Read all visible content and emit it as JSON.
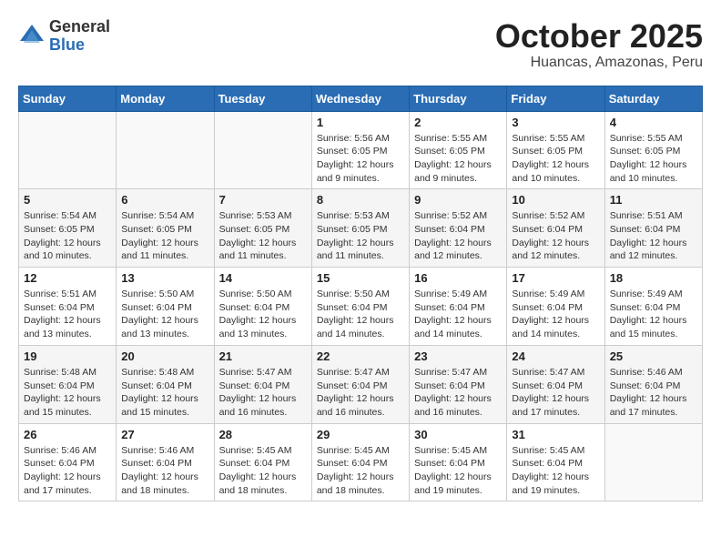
{
  "logo": {
    "general": "General",
    "blue": "Blue"
  },
  "header": {
    "month": "October 2025",
    "location": "Huancas, Amazonas, Peru"
  },
  "days_of_week": [
    "Sunday",
    "Monday",
    "Tuesday",
    "Wednesday",
    "Thursday",
    "Friday",
    "Saturday"
  ],
  "weeks": [
    [
      {
        "day": "",
        "info": ""
      },
      {
        "day": "",
        "info": ""
      },
      {
        "day": "",
        "info": ""
      },
      {
        "day": "1",
        "info": "Sunrise: 5:56 AM\nSunset: 6:05 PM\nDaylight: 12 hours\nand 9 minutes."
      },
      {
        "day": "2",
        "info": "Sunrise: 5:55 AM\nSunset: 6:05 PM\nDaylight: 12 hours\nand 9 minutes."
      },
      {
        "day": "3",
        "info": "Sunrise: 5:55 AM\nSunset: 6:05 PM\nDaylight: 12 hours\nand 10 minutes."
      },
      {
        "day": "4",
        "info": "Sunrise: 5:55 AM\nSunset: 6:05 PM\nDaylight: 12 hours\nand 10 minutes."
      }
    ],
    [
      {
        "day": "5",
        "info": "Sunrise: 5:54 AM\nSunset: 6:05 PM\nDaylight: 12 hours\nand 10 minutes."
      },
      {
        "day": "6",
        "info": "Sunrise: 5:54 AM\nSunset: 6:05 PM\nDaylight: 12 hours\nand 11 minutes."
      },
      {
        "day": "7",
        "info": "Sunrise: 5:53 AM\nSunset: 6:05 PM\nDaylight: 12 hours\nand 11 minutes."
      },
      {
        "day": "8",
        "info": "Sunrise: 5:53 AM\nSunset: 6:05 PM\nDaylight: 12 hours\nand 11 minutes."
      },
      {
        "day": "9",
        "info": "Sunrise: 5:52 AM\nSunset: 6:04 PM\nDaylight: 12 hours\nand 12 minutes."
      },
      {
        "day": "10",
        "info": "Sunrise: 5:52 AM\nSunset: 6:04 PM\nDaylight: 12 hours\nand 12 minutes."
      },
      {
        "day": "11",
        "info": "Sunrise: 5:51 AM\nSunset: 6:04 PM\nDaylight: 12 hours\nand 12 minutes."
      }
    ],
    [
      {
        "day": "12",
        "info": "Sunrise: 5:51 AM\nSunset: 6:04 PM\nDaylight: 12 hours\nand 13 minutes."
      },
      {
        "day": "13",
        "info": "Sunrise: 5:50 AM\nSunset: 6:04 PM\nDaylight: 12 hours\nand 13 minutes."
      },
      {
        "day": "14",
        "info": "Sunrise: 5:50 AM\nSunset: 6:04 PM\nDaylight: 12 hours\nand 13 minutes."
      },
      {
        "day": "15",
        "info": "Sunrise: 5:50 AM\nSunset: 6:04 PM\nDaylight: 12 hours\nand 14 minutes."
      },
      {
        "day": "16",
        "info": "Sunrise: 5:49 AM\nSunset: 6:04 PM\nDaylight: 12 hours\nand 14 minutes."
      },
      {
        "day": "17",
        "info": "Sunrise: 5:49 AM\nSunset: 6:04 PM\nDaylight: 12 hours\nand 14 minutes."
      },
      {
        "day": "18",
        "info": "Sunrise: 5:49 AM\nSunset: 6:04 PM\nDaylight: 12 hours\nand 15 minutes."
      }
    ],
    [
      {
        "day": "19",
        "info": "Sunrise: 5:48 AM\nSunset: 6:04 PM\nDaylight: 12 hours\nand 15 minutes."
      },
      {
        "day": "20",
        "info": "Sunrise: 5:48 AM\nSunset: 6:04 PM\nDaylight: 12 hours\nand 15 minutes."
      },
      {
        "day": "21",
        "info": "Sunrise: 5:47 AM\nSunset: 6:04 PM\nDaylight: 12 hours\nand 16 minutes."
      },
      {
        "day": "22",
        "info": "Sunrise: 5:47 AM\nSunset: 6:04 PM\nDaylight: 12 hours\nand 16 minutes."
      },
      {
        "day": "23",
        "info": "Sunrise: 5:47 AM\nSunset: 6:04 PM\nDaylight: 12 hours\nand 16 minutes."
      },
      {
        "day": "24",
        "info": "Sunrise: 5:47 AM\nSunset: 6:04 PM\nDaylight: 12 hours\nand 17 minutes."
      },
      {
        "day": "25",
        "info": "Sunrise: 5:46 AM\nSunset: 6:04 PM\nDaylight: 12 hours\nand 17 minutes."
      }
    ],
    [
      {
        "day": "26",
        "info": "Sunrise: 5:46 AM\nSunset: 6:04 PM\nDaylight: 12 hours\nand 17 minutes."
      },
      {
        "day": "27",
        "info": "Sunrise: 5:46 AM\nSunset: 6:04 PM\nDaylight: 12 hours\nand 18 minutes."
      },
      {
        "day": "28",
        "info": "Sunrise: 5:45 AM\nSunset: 6:04 PM\nDaylight: 12 hours\nand 18 minutes."
      },
      {
        "day": "29",
        "info": "Sunrise: 5:45 AM\nSunset: 6:04 PM\nDaylight: 12 hours\nand 18 minutes."
      },
      {
        "day": "30",
        "info": "Sunrise: 5:45 AM\nSunset: 6:04 PM\nDaylight: 12 hours\nand 19 minutes."
      },
      {
        "day": "31",
        "info": "Sunrise: 5:45 AM\nSunset: 6:04 PM\nDaylight: 12 hours\nand 19 minutes."
      },
      {
        "day": "",
        "info": ""
      }
    ]
  ]
}
